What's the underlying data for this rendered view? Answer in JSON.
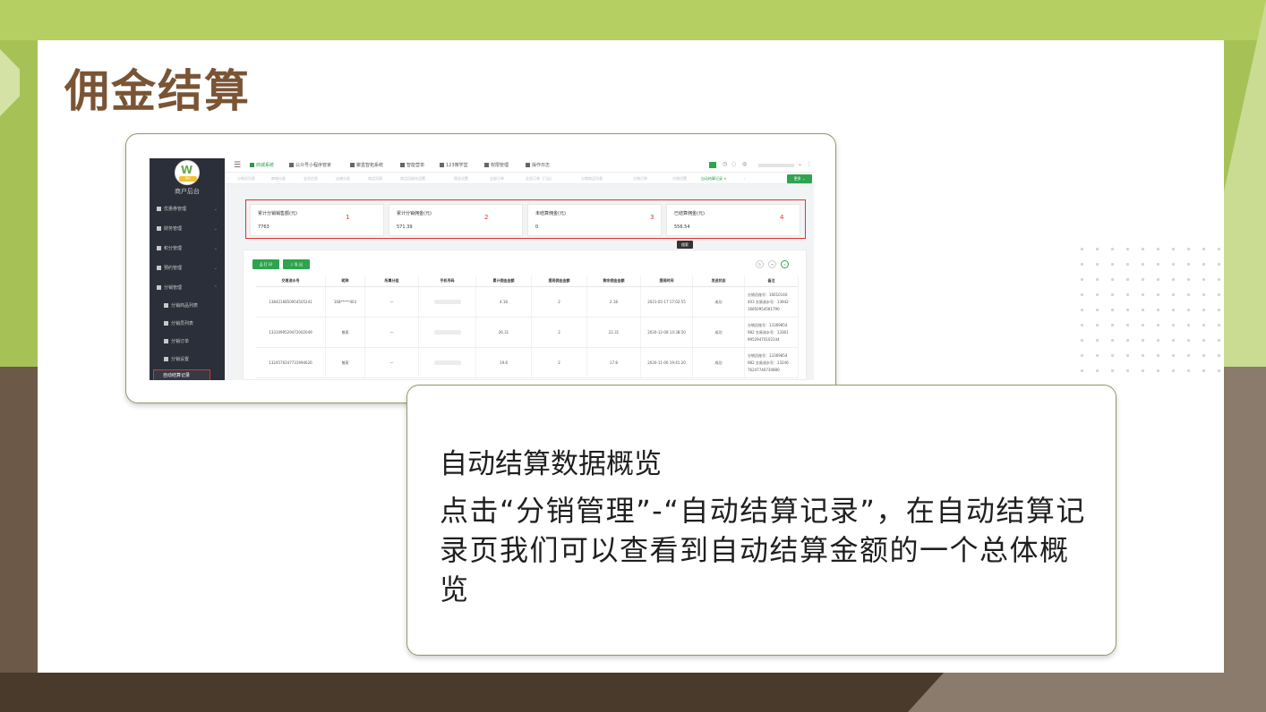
{
  "slide": {
    "title": "佣金结算",
    "caption_heading": "自动结算数据概览",
    "caption_body": "点击“分销管理”-“自动结算记录”，在自动结算记录页我们可以查看到自动结算金额的一个总体概览"
  },
  "app": {
    "brand": "W",
    "brand_sub": "微众",
    "sidebar_title": "商户后台",
    "sidebar_items": [
      "优惠券管理",
      "财务管理",
      "积分管理",
      "预约管理",
      "分销管理"
    ],
    "sidebar_subitems": [
      "分销商品列表",
      "分销员列表",
      "分销订单",
      "分销设置"
    ],
    "sidebar_active": "自动结算记录",
    "top_nav": [
      "商城系统",
      "公众号小程序管家",
      "聚盒智拓系统",
      "智能营单",
      "123微学堂",
      "权限管理",
      "操作日志"
    ],
    "tabs": [
      "分销员列表",
      "商城分类",
      "会员信息",
      "店铺分类",
      "商品列表",
      "商品回收站设置",
      "佣金设置",
      "全部订单",
      "全部订单（门店）",
      "分销商品列表",
      "分销订单",
      "分销设置",
      "自动结算记录"
    ],
    "tab_close": "×",
    "more_label": "更多",
    "stats": [
      {
        "label": "累计分销销售额(元)",
        "value": "7763",
        "marker": "1"
      },
      {
        "label": "累计分销佣金(元)",
        "value": "571.39",
        "marker": "2"
      },
      {
        "label": "未结算佣金(元)",
        "value": "0",
        "marker": "3"
      },
      {
        "label": "已结算佣金(元)",
        "value": "556.54",
        "marker": "4"
      }
    ],
    "buttons": {
      "print": "打 印",
      "export": "导 出"
    },
    "tooltip": "搜索",
    "table": {
      "headers": [
        "交易流水号",
        "昵称",
        "所属分组",
        "手机号码",
        "累计佣金金额",
        "提现佣金金额",
        "剩余佣金金额",
        "提现时间",
        "发送状态",
        "备注"
      ],
      "rows": [
        [
          "1384216850954505241",
          "168*****403",
          "—",
          "",
          "4.18",
          "2",
          "2.18",
          "2021-05-17 17:02:55",
          "成功",
          "分销员账号：16610140\n403 交易流水号：13942\n16850954581790"
        ],
        [
          "1331099529472002049",
          "曾燕",
          "—",
          "",
          "26.31",
          "2",
          "22.31",
          "2020-12-08 14:38:50",
          "成功",
          "分销员账号：13369854\n982 交易流水号：13361\n99529470102144"
        ],
        [
          "1324576247731994626",
          "曾燕",
          "—",
          "",
          "19.8",
          "2",
          "17.8",
          "2020-11-06 19:41:20",
          "成功",
          "分销员账号：13369854\n982 交易流水号：13246\n76247746730880"
        ]
      ]
    }
  },
  "colors": {
    "accent_green": "#a6c257",
    "brown": "#7a5434",
    "app_green": "#2ea44f",
    "highlight_red": "#dd3333"
  },
  "icons": [
    "menu-icon",
    "refresh-icon",
    "filter-icon",
    "search-icon",
    "chevron-down-icon"
  ]
}
